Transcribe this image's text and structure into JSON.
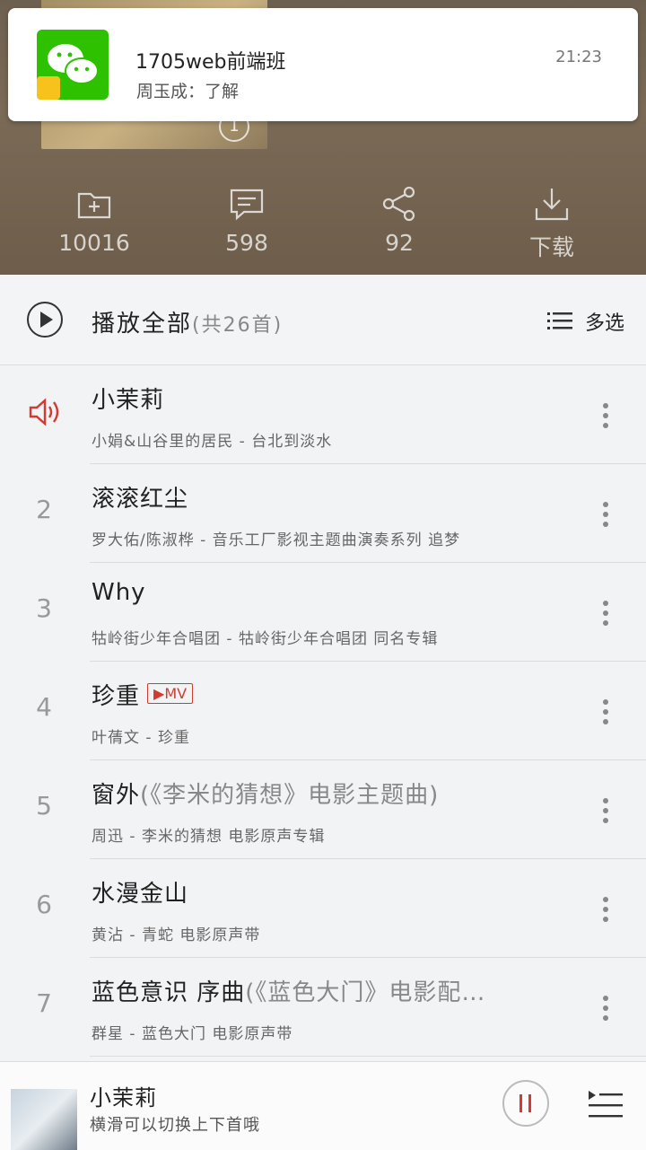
{
  "notification": {
    "title": "1705web前端班",
    "message": "周玉成：了解",
    "time": "21:23"
  },
  "header": {
    "cover_count": "1",
    "stats": [
      {
        "icon": "folder-add-icon",
        "label": "10016"
      },
      {
        "icon": "comment-icon",
        "label": "598"
      },
      {
        "icon": "share-icon",
        "label": "92"
      },
      {
        "icon": "download-icon",
        "label": "下载"
      }
    ]
  },
  "playall": {
    "label": "播放全部",
    "count": "(共26首)",
    "multi_select": "多选"
  },
  "songs": [
    {
      "num": "",
      "title": "小茉莉",
      "extra": "",
      "mv": "",
      "sub": "小娟&山谷里的居民 - 台北到淡水"
    },
    {
      "num": "2",
      "title": "滚滚红尘",
      "extra": "",
      "mv": "",
      "sub": "罗大佑/陈淑桦 - 音乐工厂影视主题曲演奏系列 追梦"
    },
    {
      "num": "3",
      "title": "Why",
      "extra": "",
      "mv": "",
      "sub": "牯岭街少年合唱团 - 牯岭街少年合唱团 同名专辑"
    },
    {
      "num": "4",
      "title": "珍重",
      "extra": "",
      "mv": "▶MV",
      "sub": "叶蒨文 - 珍重"
    },
    {
      "num": "5",
      "title": "窗外",
      "extra": "(《李米的猜想》电影主题曲)",
      "mv": "",
      "sub": "周迅 - 李米的猜想 电影原声专辑"
    },
    {
      "num": "6",
      "title": "水漫金山",
      "extra": "",
      "mv": "",
      "sub": "黄沾 - 青蛇 电影原声带"
    },
    {
      "num": "7",
      "title": "蓝色意识 序曲",
      "extra": "(《蓝色大门》电影配…",
      "mv": "",
      "sub": "群星 - 蓝色大门 电影原声带"
    }
  ],
  "player": {
    "title": "小茉莉",
    "subtitle": "横滑可以切换上下首哦"
  },
  "colors": {
    "accent": "#d33a31",
    "wechat_green": "#2dc100"
  }
}
